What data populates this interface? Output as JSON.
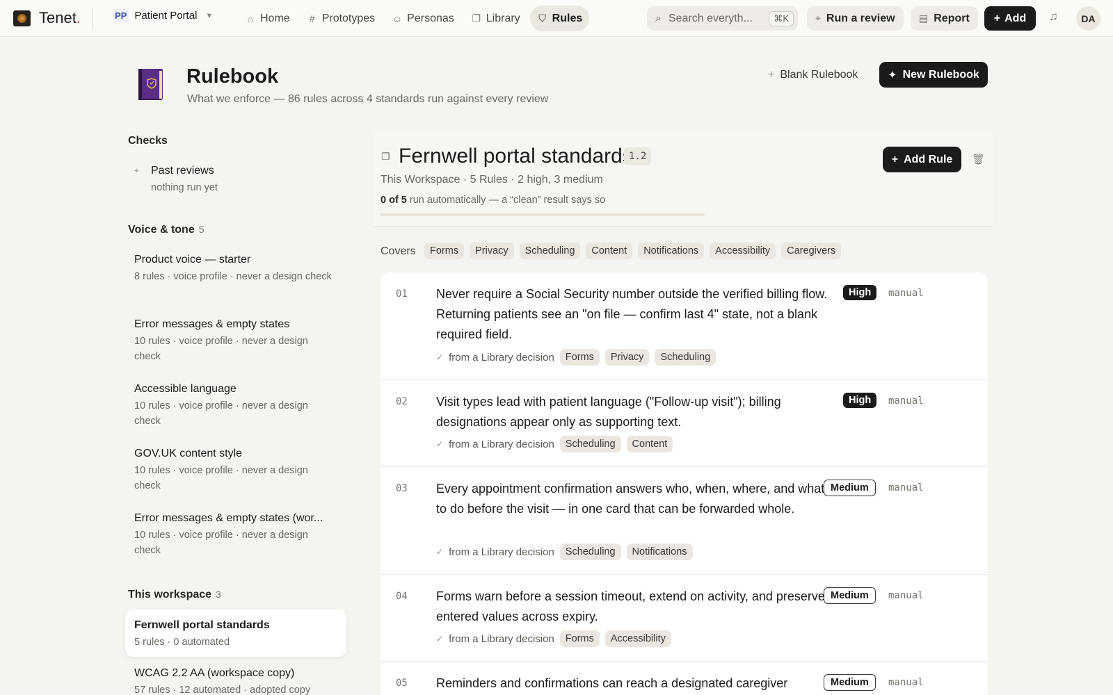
{
  "app": {
    "name": "Tenet",
    "name_dot": ".",
    "project_badge": "PP",
    "project_name": "Patient Portal"
  },
  "nav": [
    {
      "label": "Home",
      "icon": "home-icon"
    },
    {
      "label": "Prototypes",
      "icon": "hash-icon"
    },
    {
      "label": "Personas",
      "icon": "personas-icon"
    },
    {
      "label": "Library",
      "icon": "book-icon"
    },
    {
      "label": "Rules",
      "icon": "shield-icon",
      "active": true
    }
  ],
  "search": {
    "placeholder": "Search everyth...",
    "shortcut": "⌘K"
  },
  "actions": {
    "run_review": "Run a review",
    "report": "Report",
    "add": "Add"
  },
  "user": {
    "initials": "DA"
  },
  "header": {
    "title": "Rulebook",
    "subtitle": "What we enforce — 86 rules across 4 standards run against every review",
    "blank_button": "Blank Rulebook",
    "new_button": "New Rulebook"
  },
  "sidebar": {
    "checks_heading": "Checks",
    "past_reviews": {
      "title": "Past reviews",
      "meta": "nothing run yet"
    },
    "voice_heading": "Voice & tone",
    "voice_count": "5",
    "voice_items": [
      {
        "title": "Product voice — starter",
        "meta": "8 rules · voice profile · never a design check"
      },
      {
        "title": "Error messages & empty states",
        "meta": "10 rules · voice profile · never a design check"
      },
      {
        "title": "Accessible language",
        "meta": "10 rules · voice profile · never a design check"
      },
      {
        "title": "GOV.UK content style",
        "meta": "10 rules · voice profile · never a design check"
      },
      {
        "title": "Error messages & empty states (wor...",
        "meta": "10 rules · voice profile · never a design check"
      }
    ],
    "workspace_heading": "This workspace",
    "workspace_count": "3",
    "workspace_items": [
      {
        "title": "Fernwell portal standards",
        "meta": "5 rules · 0 automated",
        "active": true
      },
      {
        "title": "WCAG 2.2 AA (workspace copy)",
        "meta": "57 rules · 12 automated · adopted copy"
      }
    ]
  },
  "rulebook": {
    "title": "Fernwell portal standards",
    "version": "1.2",
    "meta": "This Workspace · 5 Rules · 2 high, 3 medium",
    "auto_count": "0 of 5",
    "auto_text": "run automatically — a “clean” result says so",
    "automated_fraction": 0,
    "add_rule": "Add Rule",
    "covers_label": "Covers",
    "covers": [
      "Forms",
      "Privacy",
      "Scheduling",
      "Content",
      "Notifications",
      "Accessibility",
      "Caregivers"
    ]
  },
  "rules": [
    {
      "num": "01",
      "text": "Never require a Social Security number outside the verified billing flow. Returning patients see an \"on file — confirm last 4\" state, not a blank required field.",
      "severity": "High",
      "mode": "manual",
      "source": "from a Library decision",
      "tags": [
        "Forms",
        "Privacy",
        "Scheduling"
      ]
    },
    {
      "num": "02",
      "text": "Visit types lead with patient language (\"Follow-up visit\"); billing designations appear only as supporting text.",
      "severity": "High",
      "mode": "manual",
      "source": "from a Library decision",
      "tags": [
        "Scheduling",
        "Content"
      ]
    },
    {
      "num": "03",
      "text": "Every appointment confirmation answers who, when, where, and what to do before the visit — in one card that can be forwarded whole.",
      "severity": "Medium",
      "mode": "manual",
      "source": "from a Library decision",
      "tags": [
        "Scheduling",
        "Notifications"
      ]
    },
    {
      "num": "04",
      "text": "Forms warn before a session timeout, extend on activity, and preserve entered values across expiry.",
      "severity": "Medium",
      "mode": "manual",
      "source": "from a Library decision",
      "tags": [
        "Forms",
        "Accessibility"
      ]
    },
    {
      "num": "05",
      "text": "Reminders and confirmations can reach a designated caregiver",
      "severity": "Medium",
      "mode": "manual"
    }
  ]
}
